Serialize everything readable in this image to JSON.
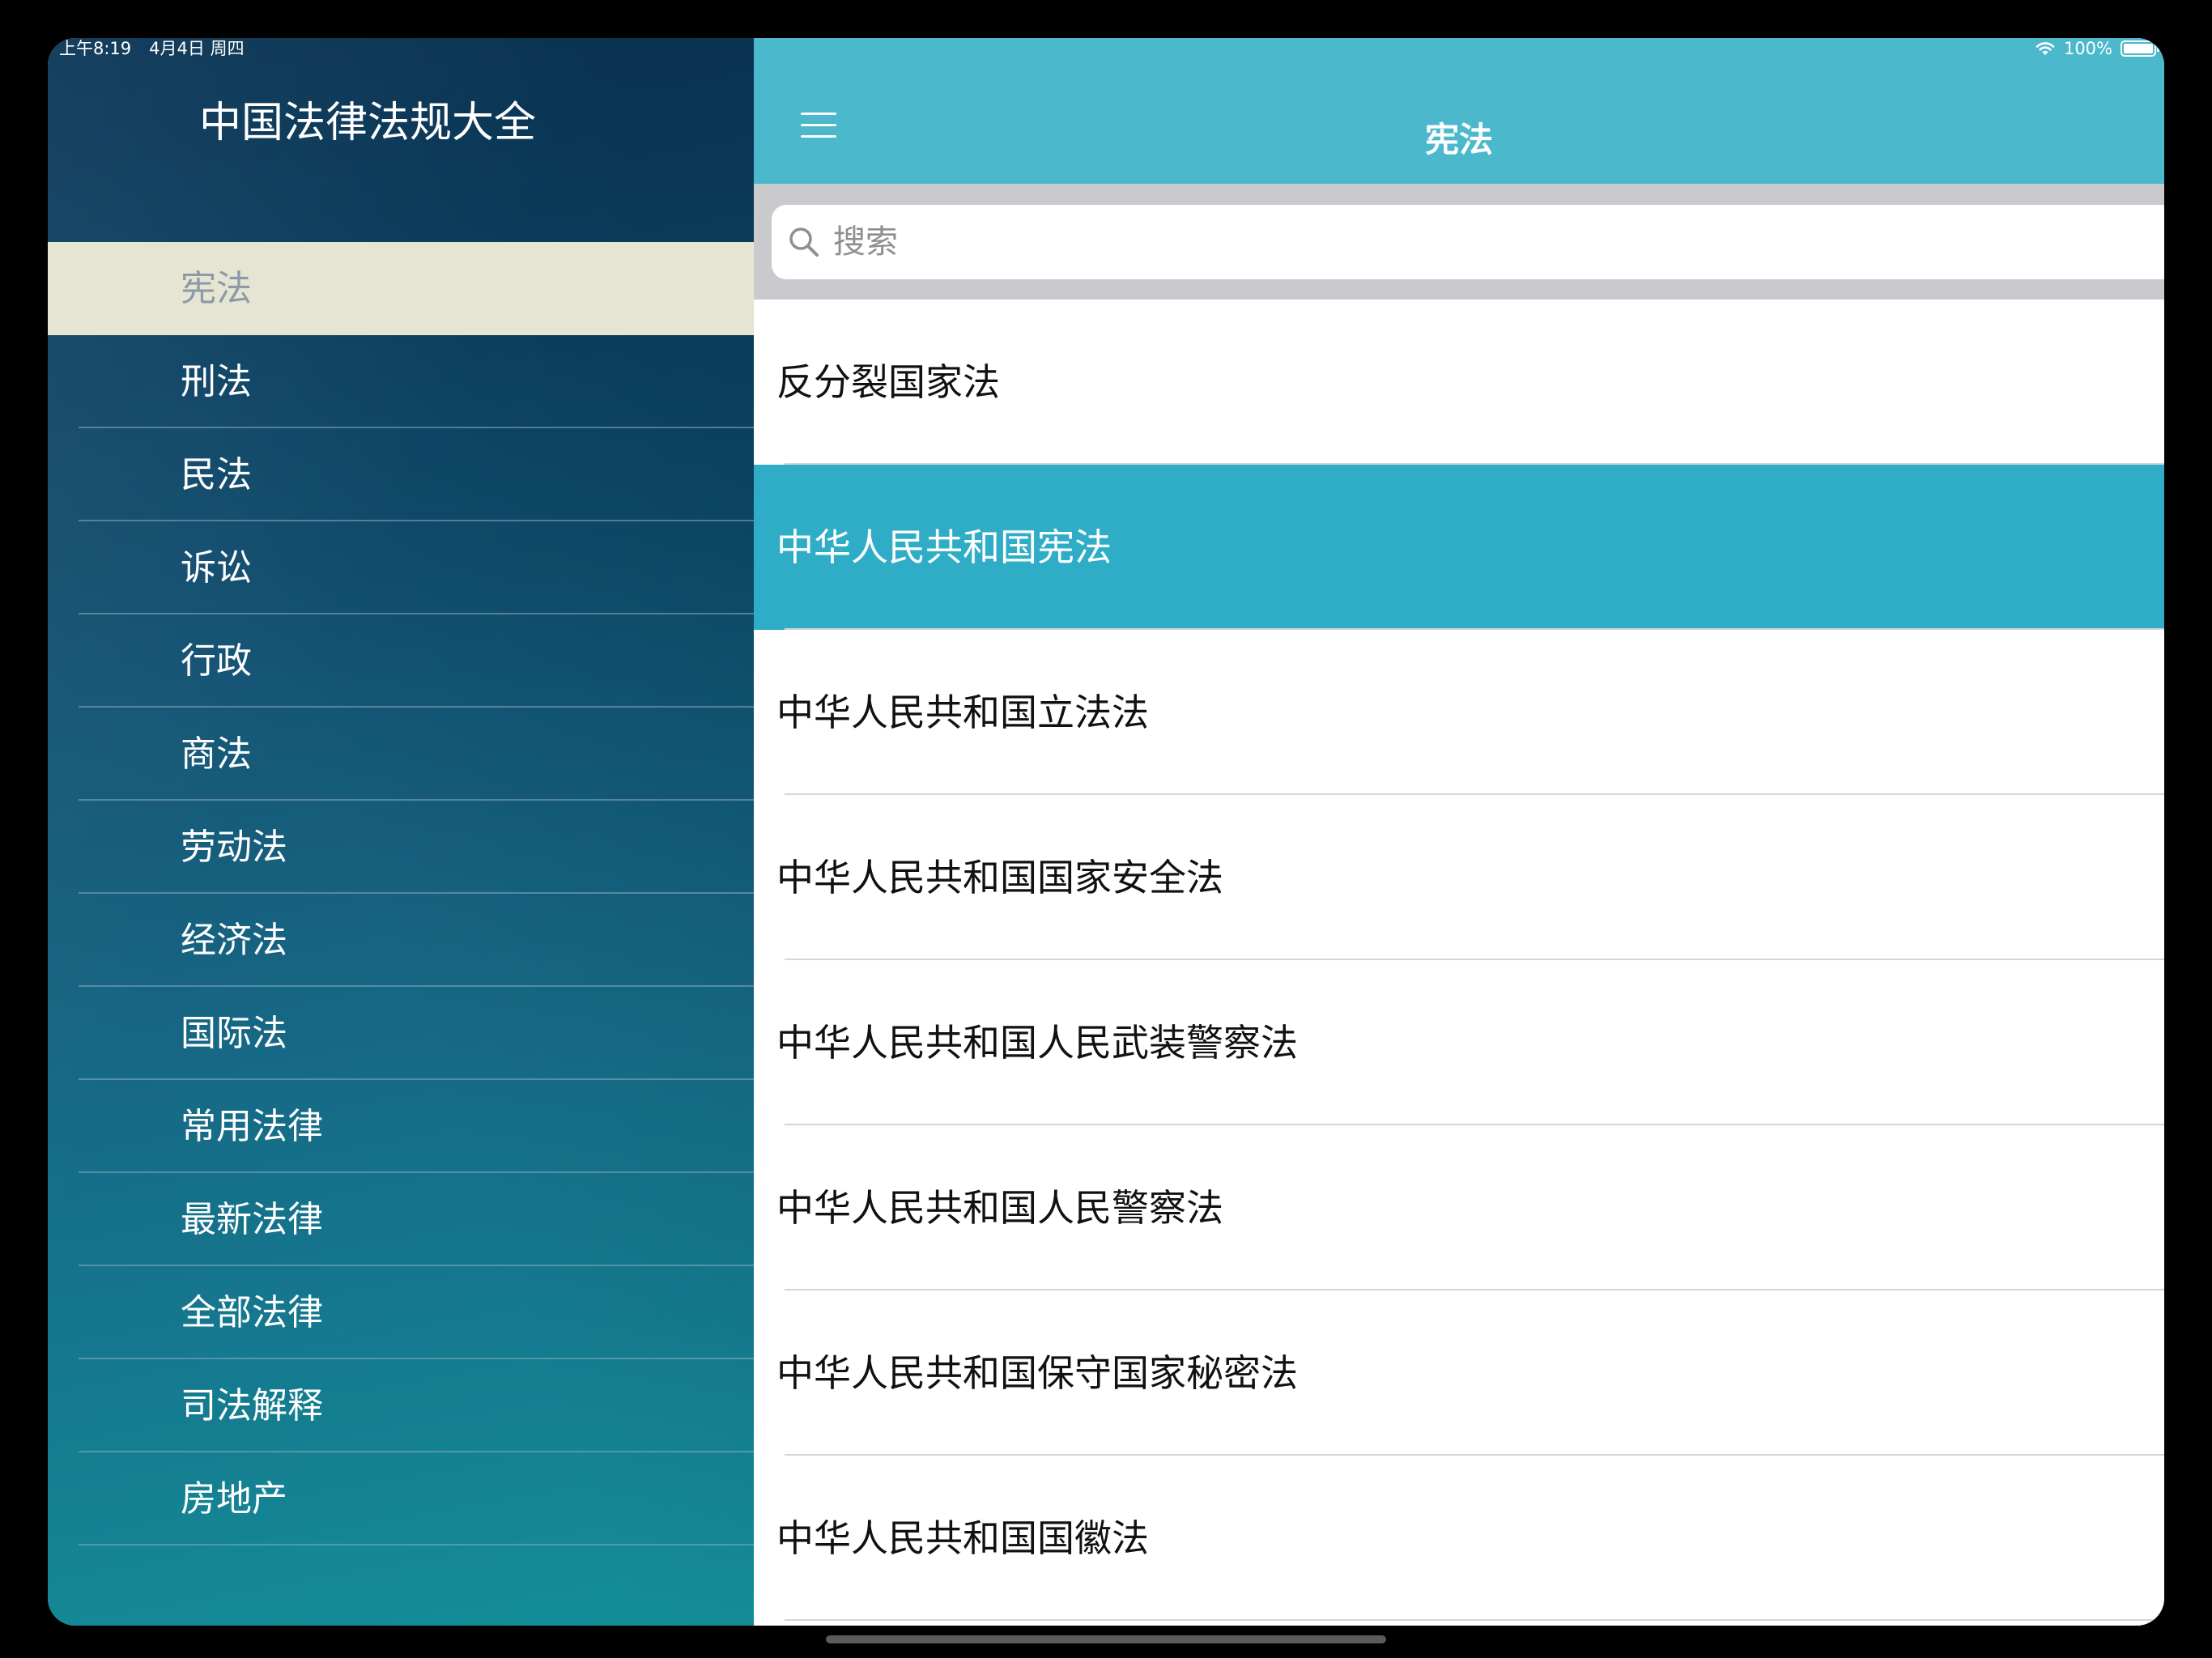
{
  "status_bar": {
    "time": "上午8:19",
    "date": "4月4日 周四",
    "battery": "100%"
  },
  "sidebar": {
    "title": "中国法律法规大全",
    "items": [
      {
        "label": "宪法"
      },
      {
        "label": "刑法"
      },
      {
        "label": "民法"
      },
      {
        "label": "诉讼"
      },
      {
        "label": "行政"
      },
      {
        "label": "商法"
      },
      {
        "label": "劳动法"
      },
      {
        "label": "经济法"
      },
      {
        "label": "国际法"
      },
      {
        "label": "常用法律"
      },
      {
        "label": "最新法律"
      },
      {
        "label": "全部法律"
      },
      {
        "label": "司法解释"
      },
      {
        "label": "房地产"
      }
    ],
    "active_index": 0
  },
  "navbar": {
    "title": "宪法"
  },
  "search": {
    "placeholder": "搜索"
  },
  "list": {
    "items": [
      {
        "label": "反分裂国家法"
      },
      {
        "label": "中华人民共和国宪法"
      },
      {
        "label": "中华人民共和国立法法"
      },
      {
        "label": "中华人民共和国国家安全法"
      },
      {
        "label": "中华人民共和国人民武装警察法"
      },
      {
        "label": "中华人民共和国人民警察法"
      },
      {
        "label": "中华人民共和国保守国家秘密法"
      },
      {
        "label": "中华人民共和国国徽法"
      }
    ],
    "selected_index": 1
  },
  "colors": {
    "navbar": "#4bb8cc",
    "selected_row": "#2fadc7",
    "sidebar_active": "#e6e4d2",
    "search_bar_bg": "#c9c9ce"
  }
}
